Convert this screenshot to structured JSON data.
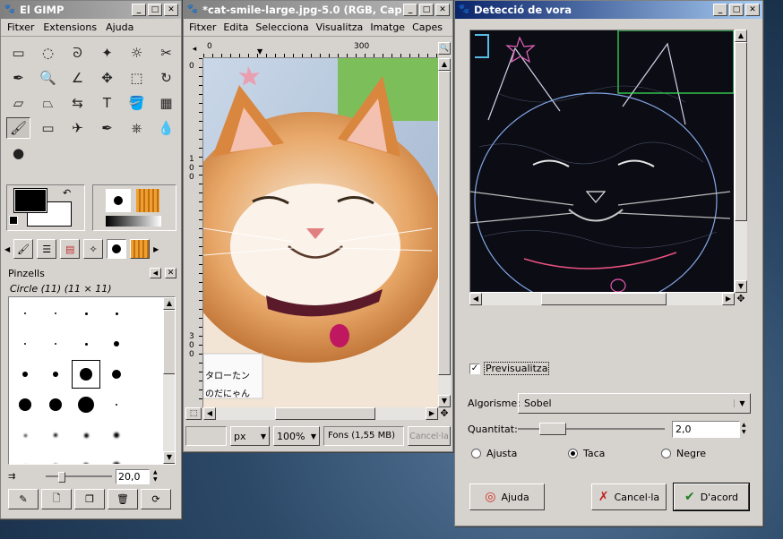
{
  "toolbox": {
    "title": "El GIMP",
    "menu": [
      "Fitxer",
      "Extensions",
      "Ajuda"
    ],
    "tool_icons": [
      "rect-select-icon",
      "ellipse-select-icon",
      "lasso-icon",
      "fuzzy-select-icon",
      "color-select-icon",
      "scissors-icon",
      "paths-icon",
      "color-picker-icon",
      "zoom-icon",
      "measure-icon",
      "move-icon",
      "crop-icon",
      "rotate-icon",
      "scale-icon",
      "shear-icon",
      "perspective-icon",
      "flip-icon",
      "text-icon",
      "bucket-fill-icon",
      "blend-icon",
      "pencil-icon",
      "paintbrush-icon",
      "eraser-icon",
      "airbrush-icon",
      "ink-icon",
      "clone-icon",
      "blur-icon",
      "smudge-icon",
      "dodge-icon"
    ],
    "tool_glyphs": [
      "▭",
      "◌",
      "ᘐ",
      "✦",
      "☼",
      "✂",
      "∿",
      "✒",
      "🔍",
      "∠",
      "✥",
      "⬚",
      "↻",
      "⇲",
      "▱",
      "⏢",
      "⇆",
      "T",
      "🪣",
      "▦",
      "✏",
      "🖌",
      "▭",
      "✈",
      "✒",
      "⎈",
      "💧",
      "☞",
      "●"
    ],
    "brushes_title": "Pinzells",
    "brush_name": "Circle (11) (11 × 11)",
    "spacing_value": "20,0",
    "fg_color": "#000000",
    "bg_color": "#ffffff"
  },
  "image_window": {
    "title": "*cat-smile-large.jpg-5.0 (RGB, Capa 1...",
    "menu": [
      "Fitxer",
      "Edita",
      "Selecciona",
      "Visualitza",
      "Imatge",
      "Capes"
    ],
    "ruler_ticks": [
      "0",
      "300"
    ],
    "vruler_ticks": [
      "0",
      "1 0 0",
      "3 0 0"
    ],
    "photo_sign_line1": "タローたン",
    "photo_sign_line2": "のだにゃん",
    "unit": "px",
    "zoom": "100%",
    "status": "Fons (1,55 MB)",
    "cancel_label": "Cancel·la"
  },
  "dialog": {
    "title": "Detecció de vora",
    "preview_label": "Previsualitza",
    "preview_checked": true,
    "algorithm_label": "Algorisme:",
    "algorithm_value": "Sobel",
    "amount_label": "Quantitat:",
    "amount_value": "2,0",
    "amount_fraction": 0.18,
    "radios": [
      {
        "label": "Ajusta",
        "selected": false
      },
      {
        "label": "Taca",
        "selected": true
      },
      {
        "label": "Negre",
        "selected": false
      }
    ],
    "help_label": "Ajuda",
    "cancel_label": "Cancel·la",
    "ok_label": "D'acord"
  }
}
